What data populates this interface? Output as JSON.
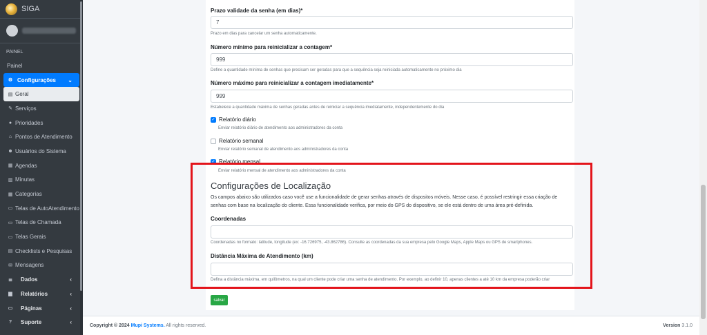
{
  "app": {
    "name": "SIGA"
  },
  "sidebar": {
    "header": "PAINEL",
    "items": [
      {
        "label": "Painel",
        "icon": ""
      },
      {
        "label": "Configurações",
        "icon": "cogs-icon",
        "caret": "⌄"
      },
      {
        "label": "Geral",
        "icon": "print-icon"
      },
      {
        "label": "Serviços",
        "icon": "wrench-icon"
      },
      {
        "label": "Prioridades",
        "icon": "info-circle-icon"
      },
      {
        "label": "Pontos de Atendimento",
        "icon": "home-icon"
      },
      {
        "label": "Usuários do Sistema",
        "icon": "users-icon"
      },
      {
        "label": "Agendas",
        "icon": "calendar-icon"
      },
      {
        "label": "Minutas",
        "icon": "file-icon"
      },
      {
        "label": "Categorias",
        "icon": "list-icon"
      },
      {
        "label": "Telas de AutoAtendimento",
        "icon": "desktop-icon"
      },
      {
        "label": "Telas de Chamada",
        "icon": "desktop-icon"
      },
      {
        "label": "Telas Gerais",
        "icon": "desktop-icon"
      },
      {
        "label": "Checklists e Pesquisas",
        "icon": "checklist-icon"
      },
      {
        "label": "Mensagens",
        "icon": "envelope-icon"
      },
      {
        "label": "Dados",
        "icon": "database-icon",
        "caret": "‹"
      },
      {
        "label": "Relatórios",
        "icon": "chart-icon",
        "caret": "‹"
      },
      {
        "label": "Páginas",
        "icon": "desktop-icon",
        "caret": "‹"
      },
      {
        "label": "Suporte",
        "icon": "question-icon",
        "caret": "‹"
      }
    ]
  },
  "form": {
    "prazo_label": "Prazo validade da senha (em dias)*",
    "prazo_value": "7",
    "prazo_help": "Prazo em dias para cancelar um senha automaticamente.",
    "min_label": "Número mínimo para reinicializar a contagem*",
    "min_value": "999",
    "min_help": "Define a quantidade mínima de senhas que precisam ser geradas para que a sequência seja reiniciada automaticamente no próximo dia",
    "max_label": "Número máximo para reinicializar a contagem imediatamente*",
    "max_value": "999",
    "max_help": "Estabelece a quantidade máxima de senhas geradas antes de reiniciar a sequência imediatamente, independentemente do dia",
    "diario_label": "Relatório diário",
    "diario_help": "Enviar relatório diário de atendimento aos administradores da conta",
    "semanal_label": "Relatório semanal",
    "semanal_help": "Enviar relatório semanal de atendimento aos administradores da conta",
    "mensal_label": "Relatório mensal",
    "mensal_help": "Enviar relatório mensal de atendimento aos administradores da conta",
    "section_title": "Configurações de Localização",
    "section_desc": "Os campos abaixo são utilizados caso você use a funcionalidade de gerar senhas através de dispositos móveis. Nesse caso, é possível restringir essa criação de senhas com base na localização do cliente. Essa funcionalidade verifica, por meio do GPS do dispositivo, se ele está dentro de uma área pré-definida.",
    "coord_label": "Coordenadas",
    "coord_value": "",
    "coord_help": "Coordenadas no formato: latitude, longitude (ex: -16.726975, -43.862786). Consulte as coordenadas da sua empresa pelo Google Maps, Apple Maps ou GPS de smartphones.",
    "dist_label": "Distância Máxima de Atendimento (km)",
    "dist_value": "",
    "dist_help": "Defina a distância máxima, em quilômetros, na qual um cliente pode criar uma senha de atendimento. Por exemplo, ao definir 10, apenas clientes a até 10 km da empresa poderão criar",
    "save_label": "salvar"
  },
  "footer": {
    "copyright": "Copyright © 2024",
    "company": "Mupi Systems.",
    "rights": "All rights reserved.",
    "version_label": "Version",
    "version": "3.1.0"
  },
  "colors": {
    "accent": "#007bff",
    "success": "#28a745",
    "highlight": "#e3141b",
    "sidebar": "#343a40"
  }
}
